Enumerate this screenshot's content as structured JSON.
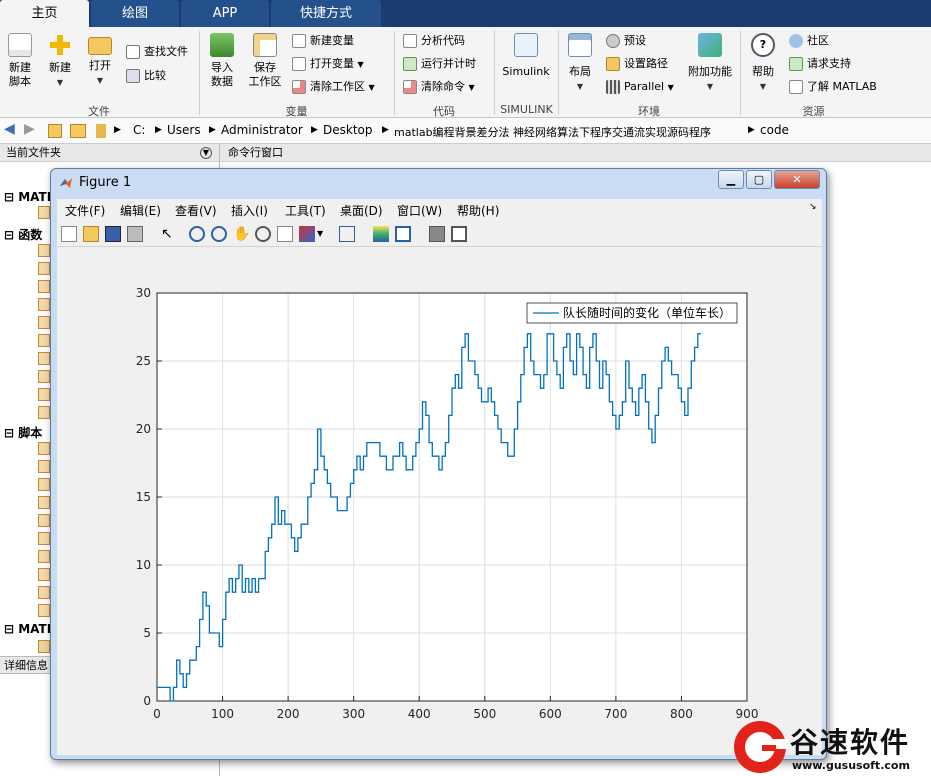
{
  "tabs": [
    {
      "label": "主页",
      "active": true
    },
    {
      "label": "绘图",
      "active": false
    },
    {
      "label": "APP",
      "active": false
    },
    {
      "label": "快捷方式",
      "active": false
    }
  ],
  "ribbon": {
    "file": {
      "group_label": "文件",
      "new_script": "新建\n脚本",
      "new": "新建",
      "open": "打开",
      "find_files": "查找文件",
      "compare": "比较"
    },
    "variable": {
      "group_label": "变量",
      "import": "导入\n数据",
      "save_workspace": "保存\n工作区",
      "new_variable": "新建变量",
      "open_variable": "打开变量",
      "clear_workspace": "清除工作区"
    },
    "code": {
      "group_label": "代码",
      "analyze": "分析代码",
      "run_time": "运行并计时",
      "clear_commands": "清除命令"
    },
    "simulink": {
      "group_label": "SIMULINK",
      "simulink": "Simulink"
    },
    "environment": {
      "group_label": "环境",
      "layout": "布局",
      "preferences": "预设",
      "set_path": "设置路径",
      "parallel": "Parallel",
      "addons": "附加功能"
    },
    "resources": {
      "group_label": "资源",
      "help": "帮助",
      "community": "社区",
      "request_support": "请求支持",
      "learn_matlab": "了解 MATLAB"
    }
  },
  "address": {
    "path": [
      "C:",
      "Users",
      "Administrator",
      "Desktop",
      "matlab编程背景差分法 神经网络算法下程序交通流实现源码程序",
      "code"
    ]
  },
  "left_panel": {
    "title": "当前文件夹",
    "sections": [
      "MATL",
      "函数",
      "脚本",
      "MATL"
    ],
    "details": "详细信息"
  },
  "command_window": {
    "title": "命令行窗口"
  },
  "figure": {
    "title": "Figure 1",
    "menus": [
      "文件(F)",
      "编辑(E)",
      "查看(V)",
      "插入(I)",
      "工具(T)",
      "桌面(D)",
      "窗口(W)",
      "帮助(H)"
    ]
  },
  "chart_data": {
    "type": "line",
    "title": "",
    "xlabel": "",
    "ylabel": "",
    "xlim": [
      0,
      900
    ],
    "ylim": [
      0,
      30
    ],
    "xticks": [
      0,
      100,
      200,
      300,
      400,
      500,
      600,
      700,
      800,
      900
    ],
    "yticks": [
      0,
      5,
      10,
      15,
      20,
      25,
      30
    ],
    "grid": true,
    "legend_position": "top-right",
    "series": [
      {
        "name": "队长随时间的变化（单位车长）",
        "color": "#0072BD",
        "x": [
          0,
          10,
          20,
          25,
          30,
          35,
          40,
          45,
          50,
          55,
          60,
          65,
          70,
          75,
          80,
          85,
          90,
          95,
          100,
          105,
          110,
          115,
          120,
          125,
          130,
          135,
          140,
          145,
          150,
          155,
          160,
          165,
          170,
          175,
          180,
          185,
          190,
          195,
          200,
          205,
          210,
          215,
          220,
          225,
          230,
          235,
          240,
          245,
          250,
          255,
          260,
          265,
          270,
          275,
          280,
          285,
          290,
          295,
          300,
          305,
          310,
          315,
          320,
          325,
          330,
          335,
          340,
          345,
          350,
          355,
          360,
          365,
          370,
          375,
          380,
          385,
          390,
          395,
          400,
          405,
          410,
          415,
          420,
          425,
          430,
          435,
          440,
          445,
          450,
          455,
          460,
          465,
          470,
          475,
          480,
          485,
          490,
          495,
          500,
          505,
          510,
          515,
          520,
          525,
          530,
          535,
          540,
          545,
          550,
          555,
          560,
          565,
          570,
          575,
          580,
          585,
          590,
          595,
          600,
          605,
          610,
          615,
          620,
          625,
          630,
          635,
          640,
          645,
          650,
          655,
          660,
          665,
          670,
          675,
          680,
          685,
          690,
          695,
          700,
          705,
          710,
          715,
          720,
          725,
          730,
          735,
          740,
          745,
          750,
          755,
          760,
          765,
          770,
          775,
          780,
          785,
          790,
          795,
          800,
          805,
          810,
          815,
          820,
          825,
          830
        ],
        "values": [
          1,
          1,
          0,
          1,
          3,
          2,
          1,
          2,
          3,
          3,
          4,
          6,
          8,
          7,
          5,
          5,
          5,
          4,
          6,
          8,
          9,
          8,
          9,
          10,
          8,
          9,
          8,
          9,
          8,
          9,
          9,
          11,
          12,
          13,
          15,
          13,
          14,
          13,
          13,
          12,
          11,
          12,
          13,
          13,
          15,
          16,
          17,
          20,
          18,
          17,
          16,
          15,
          15,
          14,
          14,
          14,
          15,
          16,
          17,
          18,
          17,
          18,
          19,
          19,
          19,
          19,
          18,
          18,
          17,
          17,
          18,
          18,
          19,
          18,
          17,
          17,
          18,
          19,
          20,
          22,
          21,
          19,
          18,
          18,
          17,
          18,
          19,
          21,
          23,
          24,
          23,
          26,
          27,
          25,
          25,
          24,
          23,
          22,
          22,
          23,
          22,
          21,
          20,
          19,
          19,
          18,
          18,
          20,
          22,
          24,
          26,
          27,
          25,
          24,
          24,
          23,
          24,
          27,
          27,
          25,
          24,
          23,
          26,
          27,
          25,
          24,
          27,
          26,
          24,
          23,
          26,
          27,
          25,
          23,
          25,
          24,
          22,
          21,
          20,
          21,
          22,
          25,
          23,
          22,
          21,
          23,
          24,
          22,
          20,
          19,
          21,
          23,
          25,
          26,
          25,
          24,
          24,
          23,
          22,
          21,
          23,
          25,
          26,
          27,
          27
        ]
      }
    ]
  },
  "watermark": {
    "brand": "谷速软件",
    "url": "www.gususoft.com",
    "logo_letter": "G"
  }
}
